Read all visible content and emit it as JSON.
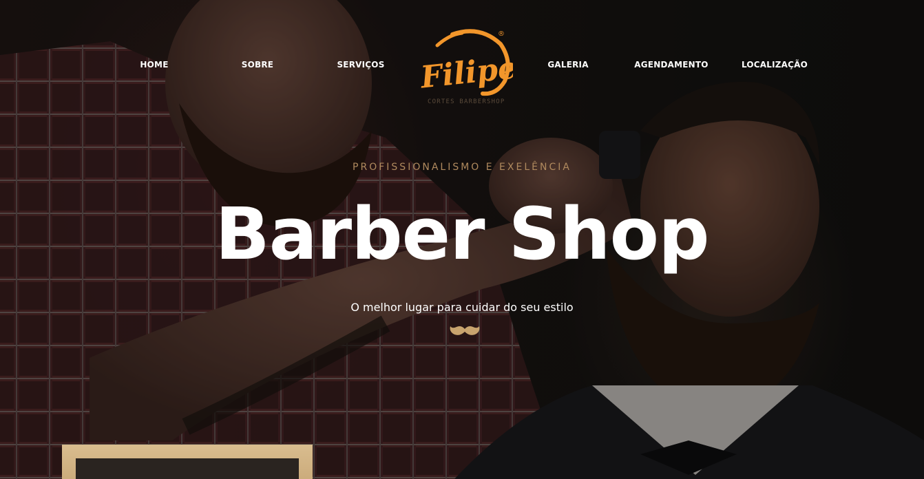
{
  "nav": {
    "items": [
      {
        "label": "HOME"
      },
      {
        "label": "SOBRE"
      },
      {
        "label": "SERVIÇOS"
      },
      {
        "label": "GALERIA"
      },
      {
        "label": "AGENDAMENTO"
      },
      {
        "label": "LOCALIZAÇÃO"
      }
    ]
  },
  "logo": {
    "name": "Filipe",
    "tagline": "CORTES BARBERSHOP",
    "registered": "®",
    "color": "#f2962b"
  },
  "hero": {
    "tagline": "PROFISSIONALISMO E EXELÊNCIA",
    "title": "Barber Shop",
    "subtitle": "O melhor lugar para cuidar do seu estilo",
    "accent_color": "#c8a46e",
    "icon": "mustache-icon"
  }
}
